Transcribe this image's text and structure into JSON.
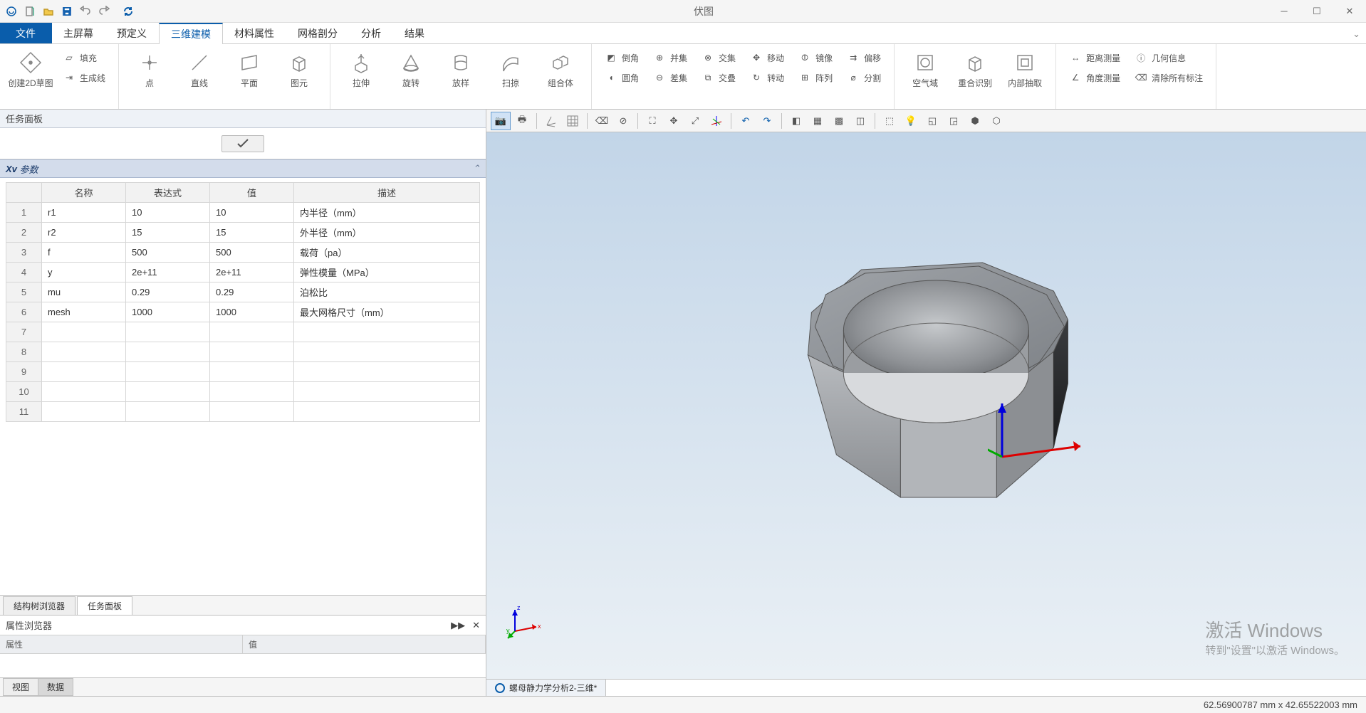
{
  "app_title": "伏图",
  "tabs": {
    "file": "文件",
    "items": [
      "主屏幕",
      "预定义",
      "三维建模",
      "材料属性",
      "网格剖分",
      "分析",
      "结果"
    ],
    "active_index": 2
  },
  "ribbon": {
    "sketch2d": "创建2D草图",
    "fill": "填充",
    "genline": "生成线",
    "point": "点",
    "line": "直线",
    "plane": "平面",
    "prim": "图元",
    "extrude": "拉伸",
    "revolve": "旋转",
    "loft": "放样",
    "sweep": "扫掠",
    "compound": "组合体",
    "fillet": "倒角",
    "round": "圆角",
    "union": "并集",
    "subtract": "差集",
    "intersect": "交集",
    "overlap": "交叠",
    "move": "移动",
    "rotate2": "转动",
    "mirror": "镜像",
    "array": "阵列",
    "offset": "偏移",
    "split": "分割",
    "airdomain": "空气域",
    "merge_ident": "重合识别",
    "inner_extract": "内部抽取",
    "dist_meas": "距离测量",
    "angle_meas": "角度测量",
    "geom_info": "几何信息",
    "clear_labels": "清除所有标注"
  },
  "task_panel": {
    "header": "任务面板",
    "params_label": "参数",
    "columns": [
      "",
      "名称",
      "表达式",
      "值",
      "描述"
    ],
    "rows": [
      {
        "n": "1",
        "name": "r1",
        "expr": "10",
        "val": "10",
        "desc": "内半径（mm）"
      },
      {
        "n": "2",
        "name": "r2",
        "expr": "15",
        "val": "15",
        "desc": "外半径（mm）"
      },
      {
        "n": "3",
        "name": "f",
        "expr": "500",
        "val": "500",
        "desc": "载荷（pa）"
      },
      {
        "n": "4",
        "name": "y",
        "expr": "2e+11",
        "val": "2e+11",
        "desc": "弹性模量（MPa）"
      },
      {
        "n": "5",
        "name": "mu",
        "expr": "0.29",
        "val": "0.29",
        "desc": "泊松比"
      },
      {
        "n": "6",
        "name": "mesh",
        "expr": "1000",
        "val": "1000",
        "desc": "最大网格尺寸（mm）"
      },
      {
        "n": "7",
        "name": "",
        "expr": "",
        "val": "",
        "desc": ""
      },
      {
        "n": "8",
        "name": "",
        "expr": "",
        "val": "",
        "desc": ""
      },
      {
        "n": "9",
        "name": "",
        "expr": "",
        "val": "",
        "desc": ""
      },
      {
        "n": "10",
        "name": "",
        "expr": "",
        "val": "",
        "desc": ""
      },
      {
        "n": "11",
        "name": "",
        "expr": "",
        "val": "",
        "desc": ""
      }
    ],
    "panel_tabs": [
      "结构树浏览器",
      "任务面板"
    ],
    "panel_tab_active": 1
  },
  "prop_browser": {
    "header": "属性浏览器",
    "col_attr": "属性",
    "col_val": "值",
    "bottom_tabs": [
      "视图",
      "数据"
    ],
    "bottom_active": 1
  },
  "doc_tab": "螺母静力学分析2-三维*",
  "status": "62.56900787 mm x 42.65522003 mm",
  "watermark": {
    "l1": "激活 Windows",
    "l2": "转到\"设置\"以激活 Windows。"
  },
  "triad": {
    "x": "x",
    "y": "y",
    "z": "z"
  },
  "xv_prefix": "Xv"
}
